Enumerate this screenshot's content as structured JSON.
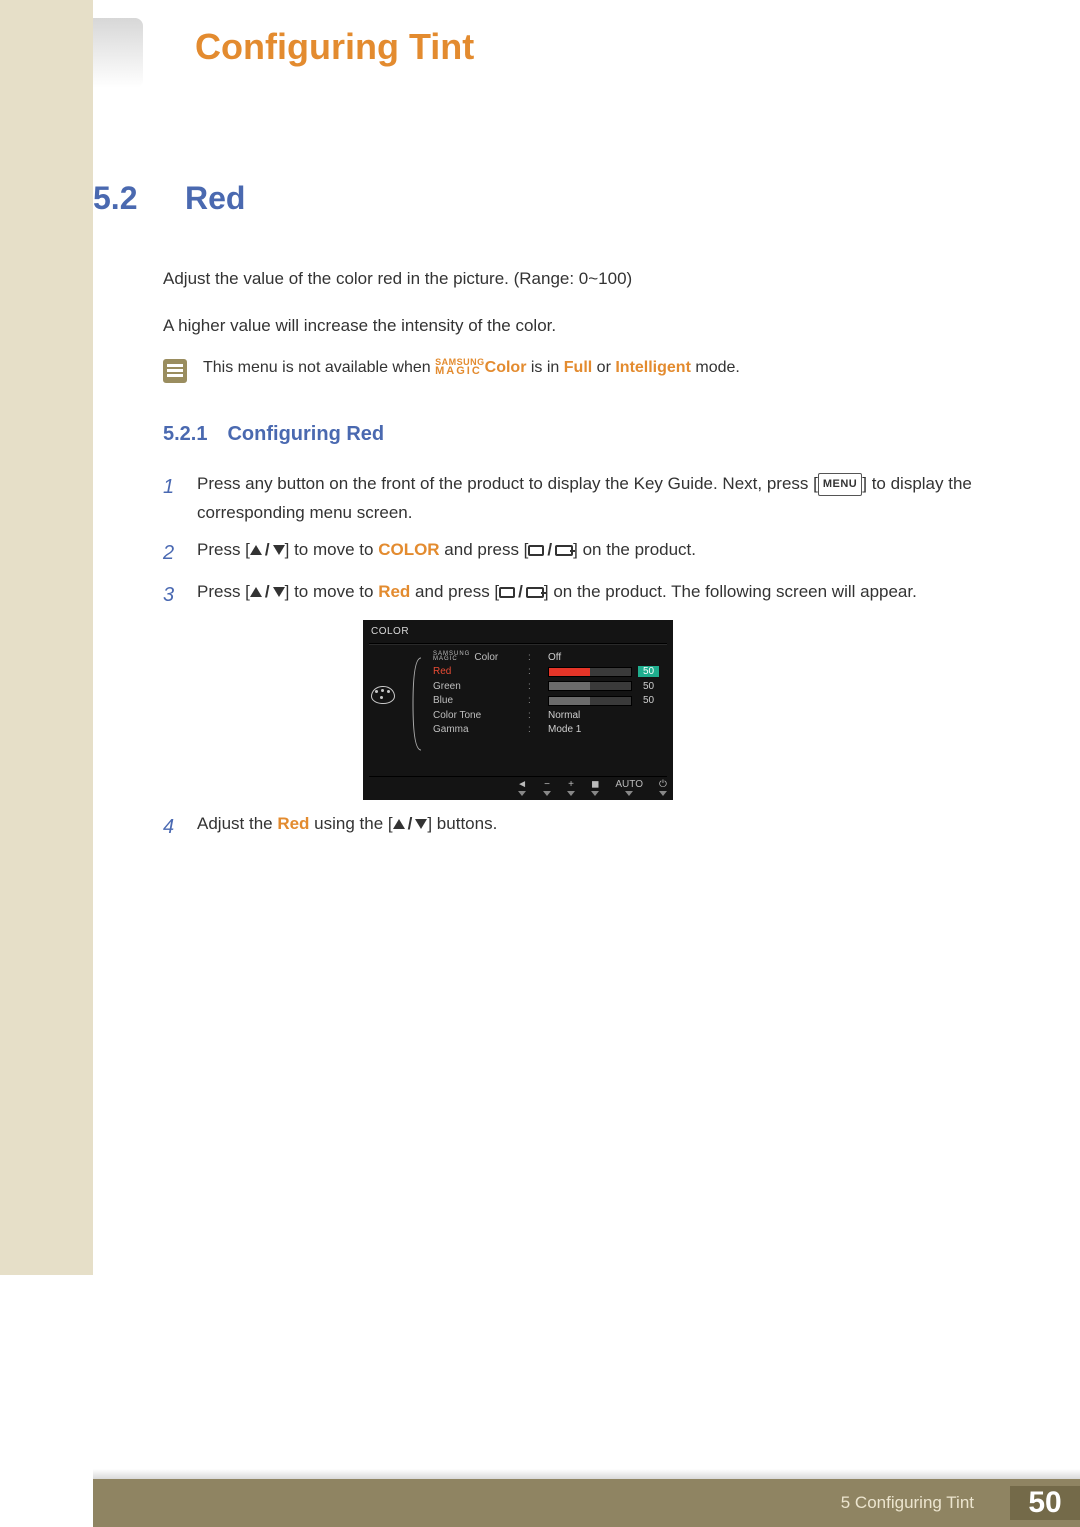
{
  "header": {
    "title": "Configuring Tint"
  },
  "section": {
    "number": "5.2",
    "title": "Red"
  },
  "intro": {
    "p1": "Adjust the value of the color red in the picture. (Range: 0~100)",
    "p2": "A higher value will increase the intensity of the color."
  },
  "note": {
    "pre": "This menu is not available when ",
    "magic_top": "SAMSUNG",
    "magic_bot": "MAGIC",
    "suffix": "Color",
    "mid": " is in ",
    "full": "Full",
    "or": " or ",
    "intel": "Intelligent",
    "end": " mode."
  },
  "subsection": {
    "number": "5.2.1",
    "title": "Configuring Red"
  },
  "steps": {
    "s1_a": "Press any button on the front of the product to display the Key Guide. Next, press [",
    "s1_menu": "MENU",
    "s1_b": "] to display the corresponding menu screen.",
    "s2_a": "Press [",
    "s2_b": "] to move to ",
    "s2_color": "COLOR",
    "s2_c": " and press [",
    "s2_d": "] on the product.",
    "s3_a": "Press [",
    "s3_b": "] to move to ",
    "s3_red": "Red",
    "s3_c": " and press [",
    "s3_d": "] on the product. The following screen will appear.",
    "s4_a": "Adjust the ",
    "s4_red": "Red",
    "s4_b": " using the [",
    "s4_c": "] buttons."
  },
  "osd": {
    "title": "COLOR",
    "magic_top": "SAMSUNG",
    "magic_bot": "MAGIC",
    "magic_suffix": "Color",
    "labels": {
      "red": "Red",
      "green": "Green",
      "blue": "Blue",
      "tone": "Color Tone",
      "gamma": "Gamma"
    },
    "values": {
      "magic": "Off",
      "red": "50",
      "green": "50",
      "blue": "50",
      "tone": "Normal",
      "gamma": "Mode 1"
    },
    "foot_auto": "AUTO"
  },
  "footer": {
    "path": "5 Configuring Tint",
    "page": "50"
  }
}
